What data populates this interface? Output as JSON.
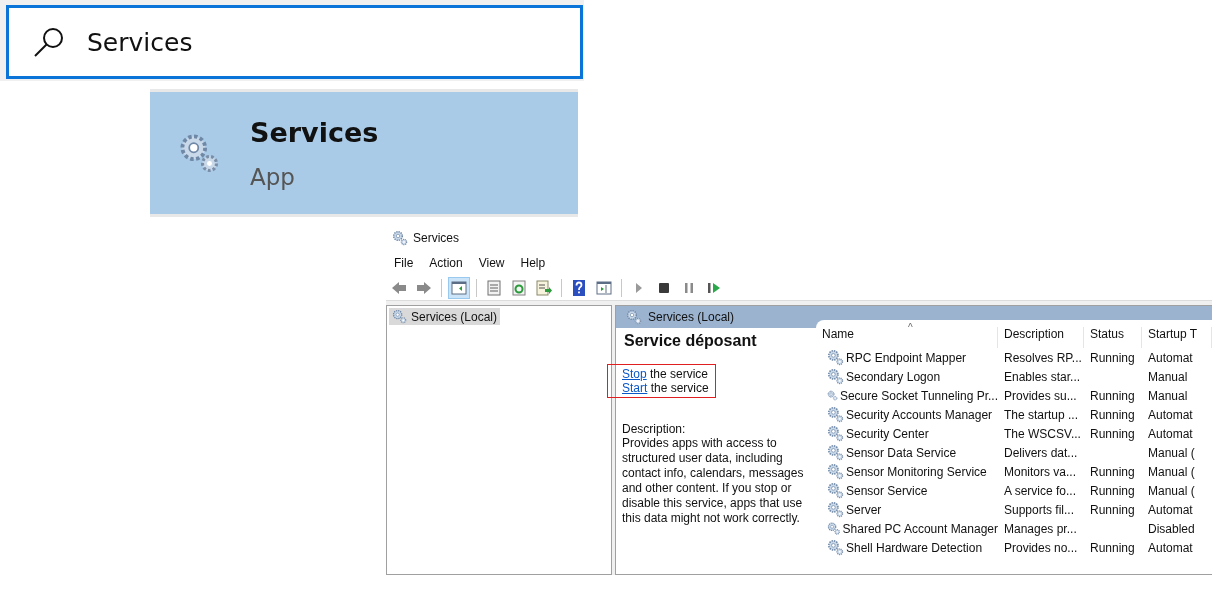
{
  "search": {
    "value": "Services"
  },
  "search_results": [
    {
      "title": "Services",
      "subtitle": "App",
      "selected": true
    }
  ],
  "window": {
    "title": "Services"
  },
  "menu": [
    "File",
    "Action",
    "View",
    "Help"
  ],
  "toolbar": [
    {
      "kind": "back",
      "pressed": false
    },
    {
      "kind": "forward",
      "pressed": false
    },
    {
      "kind": "sep"
    },
    {
      "kind": "tree",
      "pressed": true
    },
    {
      "kind": "sep"
    },
    {
      "kind": "properties",
      "pressed": false
    },
    {
      "kind": "refresh",
      "pressed": false
    },
    {
      "kind": "export",
      "pressed": false
    },
    {
      "kind": "sep"
    },
    {
      "kind": "help",
      "pressed": false
    },
    {
      "kind": "pane",
      "pressed": false
    },
    {
      "kind": "sep"
    },
    {
      "kind": "play",
      "pressed": false
    },
    {
      "kind": "stop",
      "pressed": false
    },
    {
      "kind": "pause",
      "pressed": false
    },
    {
      "kind": "resume",
      "pressed": false
    }
  ],
  "tree": [
    {
      "label": "Services (Local)",
      "selected": true
    }
  ],
  "pane_header": "Services (Local)",
  "detail": {
    "title": "Service déposant",
    "actions": [
      {
        "link": "Stop",
        "text": " the service"
      },
      {
        "link": "Start",
        "text": " the service"
      }
    ],
    "description_label": "Description:",
    "description": "Provides apps with access to structured user data, including contact info, calendars, messages and other content. If you stop or disable this service, apps that use this data might not work correctly."
  },
  "table": {
    "sort_mark": "^",
    "columns": [
      "Name",
      "Description",
      "Status",
      "Startup T"
    ],
    "rows": [
      [
        "RPC Endpoint Mapper",
        "Resolves RP...",
        "Running",
        "Automat"
      ],
      [
        "Secondary Logon",
        "Enables star...",
        "",
        "Manual"
      ],
      [
        "Secure Socket Tunneling Pr...",
        "Provides su...",
        "Running",
        "Manual"
      ],
      [
        "Security Accounts Manager",
        "The startup ...",
        "Running",
        "Automat"
      ],
      [
        "Security Center",
        "The WSCSV...",
        "Running",
        "Automat"
      ],
      [
        "Sensor Data Service",
        "Delivers dat...",
        "",
        "Manual ("
      ],
      [
        "Sensor Monitoring Service",
        "Monitors va...",
        "Running",
        "Manual ("
      ],
      [
        "Sensor Service",
        "A service fo...",
        "Running",
        "Manual ("
      ],
      [
        "Server",
        "Supports fil...",
        "Running",
        "Automat"
      ],
      [
        "Shared PC Account Manager",
        "Manages pr...",
        "",
        "Disabled"
      ],
      [
        "Shell Hardware Detection",
        "Provides no...",
        "Running",
        "Automat"
      ]
    ]
  }
}
